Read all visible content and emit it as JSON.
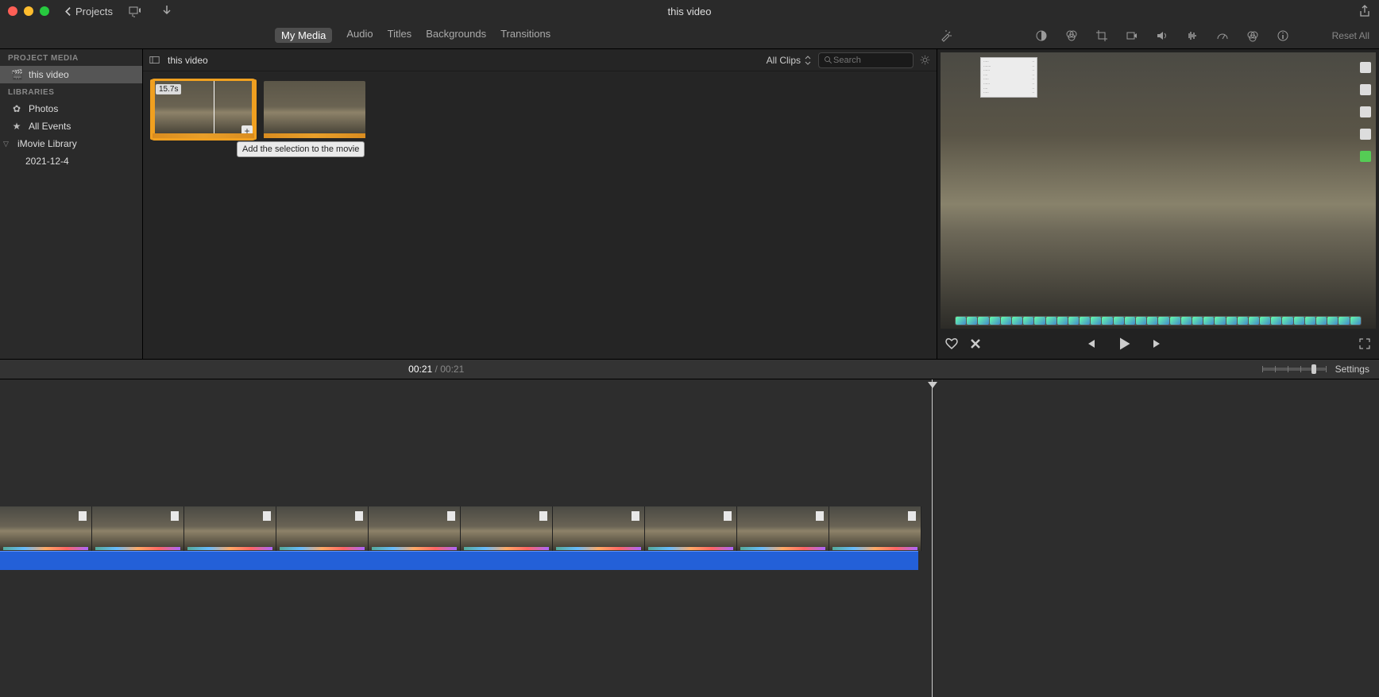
{
  "titlebar": {
    "back_label": "Projects",
    "title": "this video"
  },
  "media_tabs": {
    "my_media": "My Media",
    "audio": "Audio",
    "titles": "Titles",
    "backgrounds": "Backgrounds",
    "transitions": "Transitions"
  },
  "adjust": {
    "reset_all": "Reset All"
  },
  "sidebar": {
    "sect_project": "PROJECT MEDIA",
    "item_thisvideo": "this video",
    "sect_libraries": "LIBRARIES",
    "item_photos": "Photos",
    "item_allevents": "All Events",
    "item_imovie_lib": "iMovie Library",
    "item_2021_12_4": "2021-12-4"
  },
  "browser": {
    "title": "this video",
    "filter": "All Clips",
    "search_placeholder": "Search",
    "clip_duration": "15.7s",
    "tooltip": "Add the selection to the movie"
  },
  "timeline": {
    "current": "00:21",
    "sep": "/",
    "total": "00:21",
    "settings": "Settings"
  }
}
